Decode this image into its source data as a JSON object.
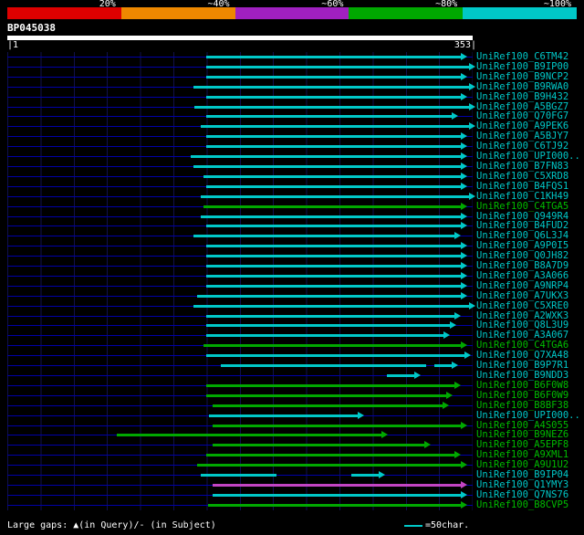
{
  "chart_data": {
    "type": "bar",
    "subtype": "blast-hit-alignment-overview",
    "orientation": "horizontal",
    "grid": true,
    "xlim": [
      1,
      353
    ],
    "query": {
      "name": "BP045038",
      "length": 353,
      "start_label": "|1",
      "end_label": "353|"
    },
    "identity_key": [
      {
        "label": "20%",
        "color": "#dd0000"
      },
      {
        "label": "~40%",
        "color": "#ee8800"
      },
      {
        "label": "~60%",
        "color": "#a020c0"
      },
      {
        "label": "~80%",
        "color": "#00a800"
      },
      {
        "label": "~100%",
        "color": "#00c8c8"
      }
    ],
    "hits": [
      {
        "name": "UniRef100_C6TM42",
        "color": "cyan",
        "spans": [
          [
            152,
            344
          ]
        ]
      },
      {
        "name": "UniRef100_B9IP00",
        "color": "cyan",
        "spans": [
          [
            152,
            350
          ]
        ]
      },
      {
        "name": "UniRef100_B9NCP2",
        "color": "cyan",
        "spans": [
          [
            152,
            344
          ]
        ]
      },
      {
        "name": "UniRef100_B9RWA0",
        "color": "cyan",
        "spans": [
          [
            142,
            350
          ]
        ]
      },
      {
        "name": "UniRef100_B9H432",
        "color": "cyan",
        "spans": [
          [
            152,
            344
          ]
        ]
      },
      {
        "name": "UniRef100_A5BGZ7",
        "color": "cyan",
        "spans": [
          [
            143,
            350
          ]
        ]
      },
      {
        "name": "UniRef100_Q70FG7",
        "color": "cyan",
        "spans": [
          [
            152,
            337
          ]
        ]
      },
      {
        "name": "UniRef100_A9PEK6",
        "color": "cyan",
        "spans": [
          [
            148,
            350
          ]
        ]
      },
      {
        "name": "UniRef100_A5BJY7",
        "color": "cyan",
        "spans": [
          [
            152,
            344
          ]
        ]
      },
      {
        "name": "UniRef100_C6TJ92",
        "color": "cyan",
        "spans": [
          [
            152,
            344
          ]
        ]
      },
      {
        "name": "UniRef100_UPI000..",
        "color": "cyan",
        "spans": [
          [
            140,
            344
          ]
        ]
      },
      {
        "name": "UniRef100_B7FN83",
        "color": "cyan",
        "spans": [
          [
            142,
            344
          ]
        ]
      },
      {
        "name": "UniRef100_C5XRD8",
        "color": "cyan",
        "spans": [
          [
            150,
            344
          ]
        ]
      },
      {
        "name": "UniRef100_B4FQS1",
        "color": "cyan",
        "spans": [
          [
            152,
            344
          ]
        ]
      },
      {
        "name": "UniRef100_C1KH49",
        "color": "cyan",
        "spans": [
          [
            148,
            350
          ]
        ]
      },
      {
        "name": "UniRef100_C4TGA5",
        "color": "green",
        "spans": [
          [
            150,
            344
          ]
        ]
      },
      {
        "name": "UniRef100_Q949R4",
        "color": "cyan",
        "spans": [
          [
            148,
            344
          ]
        ]
      },
      {
        "name": "UniRef100_B4FUD2",
        "color": "cyan",
        "spans": [
          [
            152,
            344
          ]
        ]
      },
      {
        "name": "UniRef100_Q6L3J4",
        "color": "cyan",
        "spans": [
          [
            142,
            339
          ]
        ]
      },
      {
        "name": "UniRef100_A9P0I5",
        "color": "cyan",
        "spans": [
          [
            152,
            344
          ]
        ]
      },
      {
        "name": "UniRef100_Q0JH82",
        "color": "cyan",
        "spans": [
          [
            152,
            344
          ]
        ]
      },
      {
        "name": "UniRef100_B8A7D9",
        "color": "cyan",
        "spans": [
          [
            152,
            344
          ]
        ]
      },
      {
        "name": "UniRef100_A3A066",
        "color": "cyan",
        "spans": [
          [
            152,
            344
          ]
        ]
      },
      {
        "name": "UniRef100_A9NRP4",
        "color": "cyan",
        "spans": [
          [
            152,
            344
          ]
        ]
      },
      {
        "name": "UniRef100_A7UKX3",
        "color": "cyan",
        "spans": [
          [
            145,
            344
          ]
        ]
      },
      {
        "name": "UniRef100_C5XRE0",
        "color": "cyan",
        "spans": [
          [
            142,
            350
          ]
        ]
      },
      {
        "name": "UniRef100_A2WXK3",
        "color": "cyan",
        "spans": [
          [
            152,
            339
          ]
        ]
      },
      {
        "name": "UniRef100_Q8L3U9",
        "color": "cyan",
        "spans": [
          [
            152,
            336
          ]
        ]
      },
      {
        "name": "UniRef100_A3A067",
        "color": "cyan",
        "spans": [
          [
            152,
            331
          ]
        ]
      },
      {
        "name": "UniRef100_C4TGA6",
        "color": "green",
        "spans": [
          [
            150,
            344
          ]
        ]
      },
      {
        "name": "UniRef100_Q7XA48",
        "color": "cyan",
        "spans": [
          [
            152,
            347
          ]
        ]
      },
      {
        "name": "UniRef100_B9P7R1",
        "color": "cyan",
        "spans": [
          [
            163,
            318
          ],
          [
            325,
            337
          ]
        ]
      },
      {
        "name": "UniRef100_B9NDD3",
        "color": "cyan",
        "spans": [
          [
            289,
            309
          ]
        ]
      },
      {
        "name": "UniRef100_B6F0W8",
        "color": "green",
        "spans": [
          [
            152,
            339
          ]
        ]
      },
      {
        "name": "UniRef100_B6F0W9",
        "color": "green",
        "spans": [
          [
            152,
            333
          ]
        ]
      },
      {
        "name": "UniRef100_B8BF38",
        "color": "green",
        "spans": [
          [
            157,
            330
          ]
        ]
      },
      {
        "name": "UniRef100_UPI000..",
        "color": "cyan",
        "spans": [
          [
            154,
            266
          ]
        ]
      },
      {
        "name": "UniRef100_A4S055",
        "color": "green",
        "spans": [
          [
            157,
            344
          ]
        ]
      },
      {
        "name": "UniRef100_B9NEZ6",
        "color": "green",
        "spans": [
          [
            84,
            284
          ]
        ]
      },
      {
        "name": "UniRef100_A5EPF8",
        "color": "green",
        "spans": [
          [
            157,
            316
          ]
        ]
      },
      {
        "name": "UniRef100_A9XML1",
        "color": "green",
        "spans": [
          [
            152,
            339
          ]
        ]
      },
      {
        "name": "UniRef100_A9U1U2",
        "color": "green",
        "spans": [
          [
            145,
            344
          ]
        ]
      },
      {
        "name": "UniRef100_B9IP04",
        "color": "cyan",
        "spans": [
          [
            148,
            204
          ],
          [
            262,
            282
          ]
        ]
      },
      {
        "name": "UniRef100_Q1YMY3",
        "color": "magenta",
        "label_color": "cyan",
        "spans": [
          [
            157,
            344
          ]
        ]
      },
      {
        "name": "UniRef100_Q7NS76",
        "color": "cyan",
        "spans": [
          [
            157,
            344
          ]
        ]
      },
      {
        "name": "UniRef100_B8CVP5",
        "color": "green",
        "spans": [
          [
            153,
            344
          ]
        ]
      }
    ],
    "legend": {
      "gaps": "Large gaps: ▲(in Query)/- (in Subject)",
      "scale": "=50char."
    }
  },
  "colors": {
    "background": "#000000",
    "query_bar": "#ffffff",
    "row_baseline": "#0000a8",
    "gridline": "#10104e",
    "cyan": "#00c8c8",
    "green": "#00a800",
    "magenta": "#c344c3"
  }
}
